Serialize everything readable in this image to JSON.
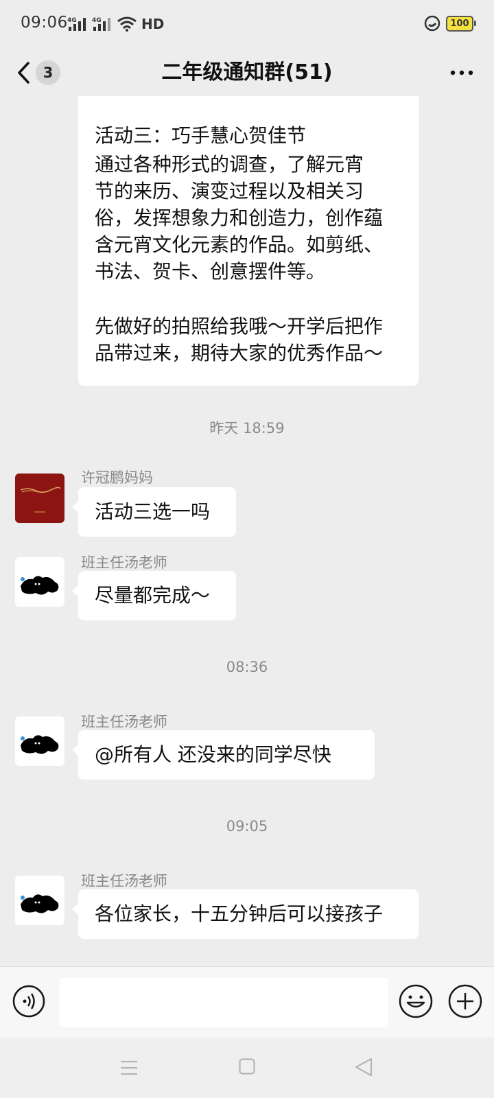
{
  "status": {
    "time": "09:06",
    "signal1": "4G",
    "signal2": "4G",
    "hd": "HD",
    "battery": "100"
  },
  "header": {
    "title": "二年级通知群(51)",
    "unread_count": "3"
  },
  "messages": {
    "first": {
      "lines": [
        "活动三：巧手慧心贺佳节",
        " 通过各种形式的调查，了解元宵",
        "节的来历、演变过程以及相关习",
        "俗，发挥想象力和创造力，创作蕴",
        "含元宵文化元素的作品。如剪纸、",
        "书法、贺卡、创意摆件等。",
        "先做好的拍照给我哦～开学后把作",
        "品带过来，期待大家的优秀作品～"
      ]
    },
    "ts1": "昨天 18:59",
    "m1": {
      "sender": "许冠鹏妈妈",
      "text": "活动三选一吗"
    },
    "m2": {
      "sender": "班主任汤老师",
      "text": "尽量都完成～"
    },
    "ts2": "08:36",
    "m3": {
      "sender": "班主任汤老师",
      "text": "@所有人  还没来的同学尽快"
    },
    "ts3": "09:05",
    "m4": {
      "sender": "班主任汤老师",
      "text": "各位家长，十五分钟后可以接孩子"
    }
  },
  "input": {
    "placeholder": ""
  },
  "icons": {
    "back": "chevron-left-icon",
    "more": "more-dots-icon",
    "voice": "voice-icon",
    "emoji": "emoji-icon",
    "plus": "plus-icon",
    "nav_menu": "menu-icon",
    "nav_home": "home-icon",
    "nav_back": "back-triangle-icon"
  }
}
